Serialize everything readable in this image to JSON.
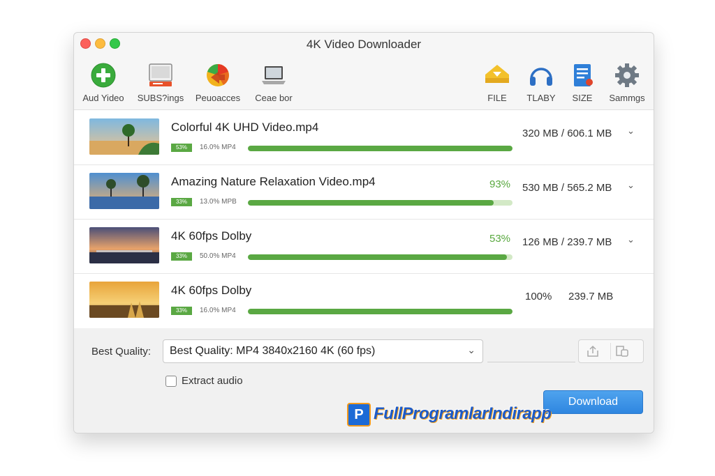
{
  "window": {
    "title": "4K Video Downloader"
  },
  "toolbar": {
    "add_video": "Aud Yideo",
    "subtitles": "SUBS?ings",
    "proxies": "Peuoacces",
    "clear": "Ceae bor",
    "file": "FILE",
    "library": "TLABY",
    "size": "SIZE",
    "settings": "Sammgs"
  },
  "downloads": [
    {
      "name": "Colorful 4K UHD Video.mp4",
      "badge": "53%",
      "meta": "16.0% MP4",
      "progress": 1.0,
      "percent_text": "",
      "size": "320 MB / 606.1 MB",
      "chevron": "⌄"
    },
    {
      "name": "Amazing Nature Relaxation Video.mp4",
      "badge": "33%",
      "meta": "13.0% MPB",
      "progress": 0.93,
      "percent_text": "93%",
      "size": "530 MB / 565.2 MB",
      "chevron": "⌄"
    },
    {
      "name": "4K 60fps Dolby",
      "badge": "33%",
      "meta": "50.0% MP4",
      "progress": 0.98,
      "percent_text": "53%",
      "size": "126 MB / 239.7 MB",
      "chevron": "⌄"
    },
    {
      "name": "4K 60fps Dolby",
      "badge": "33%",
      "meta": "16.0% MP4",
      "progress": 1.0,
      "percent_text": "100%",
      "size": "239.7 MB",
      "chevron": ""
    }
  ],
  "bottom": {
    "quality_label": "Best Quality:",
    "quality_value": "Best Quality: MP4 3840x2160 4K (60 fps)",
    "extract_audio": "Extract audio",
    "download_button": "Download"
  },
  "watermark": {
    "logo_letter": "P",
    "text": "FullProgramlarIndirapp"
  },
  "colors": {
    "accent_green": "#5aa843",
    "download_blue": "#3a8fe6"
  }
}
